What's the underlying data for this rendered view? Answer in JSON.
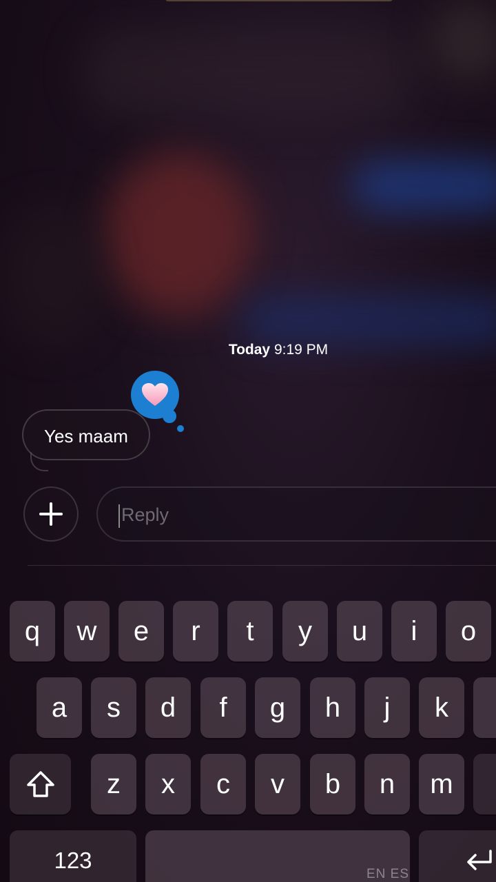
{
  "conversation": {
    "timestamp_day": "Today",
    "timestamp_time": "9:19 PM",
    "message_text": "Yes maam",
    "reaction_emoji": "heart"
  },
  "composer": {
    "placeholder": "Reply",
    "value": "",
    "add_button_icon": "plus-icon"
  },
  "keyboard": {
    "row1": [
      "q",
      "w",
      "e",
      "r",
      "t",
      "y",
      "u",
      "i",
      "o"
    ],
    "row2": [
      "a",
      "s",
      "d",
      "f",
      "g",
      "h",
      "j",
      "k"
    ],
    "row3": [
      "z",
      "x",
      "c",
      "v",
      "b",
      "n",
      "m"
    ],
    "shift_icon": "shift-icon",
    "numbers_label": "123",
    "language_label": "EN ES",
    "return_icon": "return-icon"
  },
  "colors": {
    "tapback_blue": "#1d7fd1",
    "background": "#150c18"
  }
}
